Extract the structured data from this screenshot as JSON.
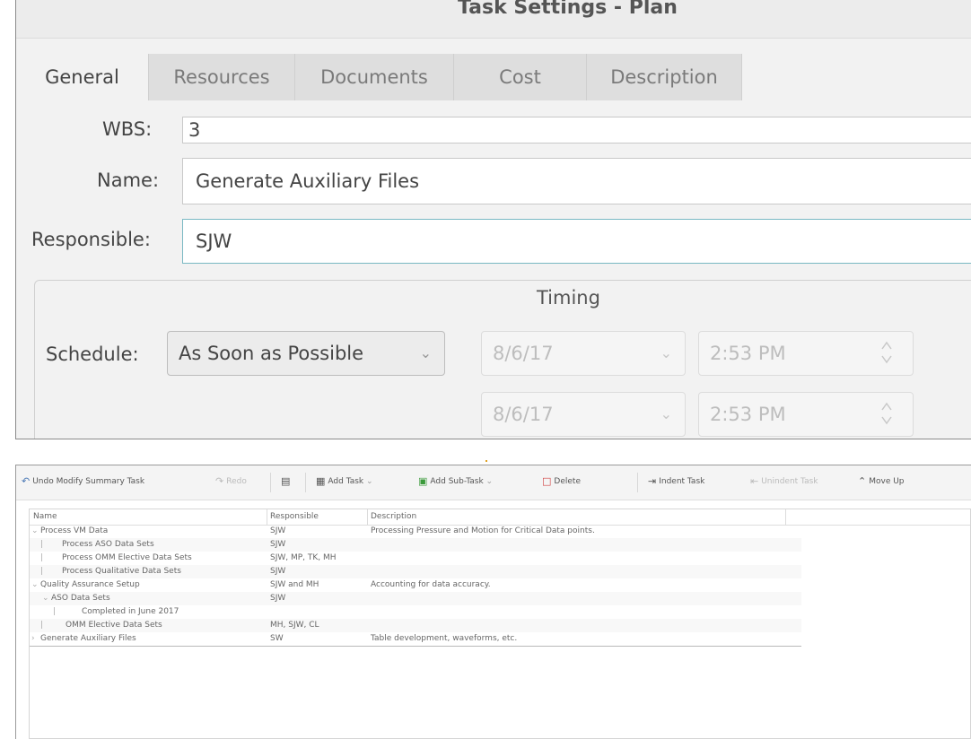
{
  "dialog": {
    "title": "Task Settings - Plan",
    "tabs": [
      "General",
      "Resources",
      "Documents",
      "Cost",
      "Description"
    ],
    "wbs_label": "WBS:",
    "wbs_value": "3",
    "name_label": "Name:",
    "name_value": "Generate Auxiliary Files",
    "responsible_label": "Responsible:",
    "responsible_value": "SJW",
    "timing_title": "Timing",
    "schedule_label": "Schedule:",
    "schedule_value": "As Soon as Possible",
    "start_date": "8/6/17",
    "start_time": "2:53 PM",
    "end_date": "8/6/17",
    "end_time": "2:53 PM"
  },
  "toolbar": {
    "undo": "Undo Modify Summary Task",
    "redo": "Redo",
    "add_task": "Add Task",
    "add_subtask": "Add Sub-Task",
    "delete": "Delete",
    "indent": "Indent Task",
    "unindent": "Unindent Task",
    "move_up": "Move Up"
  },
  "grid": {
    "columns": [
      "Name",
      "Responsible",
      "Description"
    ],
    "rows": [
      {
        "twisty": "⌄",
        "name": "Process VM Data",
        "resp": "SJW",
        "desc": "Processing Pressure and Motion for Critical Data points."
      },
      {
        "twisty": "",
        "name": "Process ASO Data Sets",
        "resp": "SJW",
        "desc": ""
      },
      {
        "twisty": "",
        "name": "Process OMM Elective Data Sets",
        "resp": "SJW, MP, TK, MH",
        "desc": ""
      },
      {
        "twisty": "",
        "name": "Process Qualitative Data Sets",
        "resp": "SJW",
        "desc": ""
      },
      {
        "twisty": "⌄",
        "name": "Quality Assurance Setup",
        "resp": "SJW and MH",
        "desc": "Accounting for data accuracy."
      },
      {
        "twisty": "⌄",
        "name": "ASO Data Sets",
        "resp": "SJW",
        "desc": ""
      },
      {
        "twisty": "",
        "name": "Completed in June 2017",
        "resp": "",
        "desc": ""
      },
      {
        "twisty": "",
        "name": "OMM Elective Data Sets",
        "resp": "MH, SJW, CL",
        "desc": ""
      },
      {
        "twisty": "›",
        "name": "Generate Auxiliary Files",
        "resp": "SW",
        "desc": "Table development, waveforms, etc."
      }
    ]
  },
  "colors": {
    "focus_border": "#79b8c3",
    "tab_inactive": "#dedede",
    "dialog_bg": "#f2f2f2"
  }
}
